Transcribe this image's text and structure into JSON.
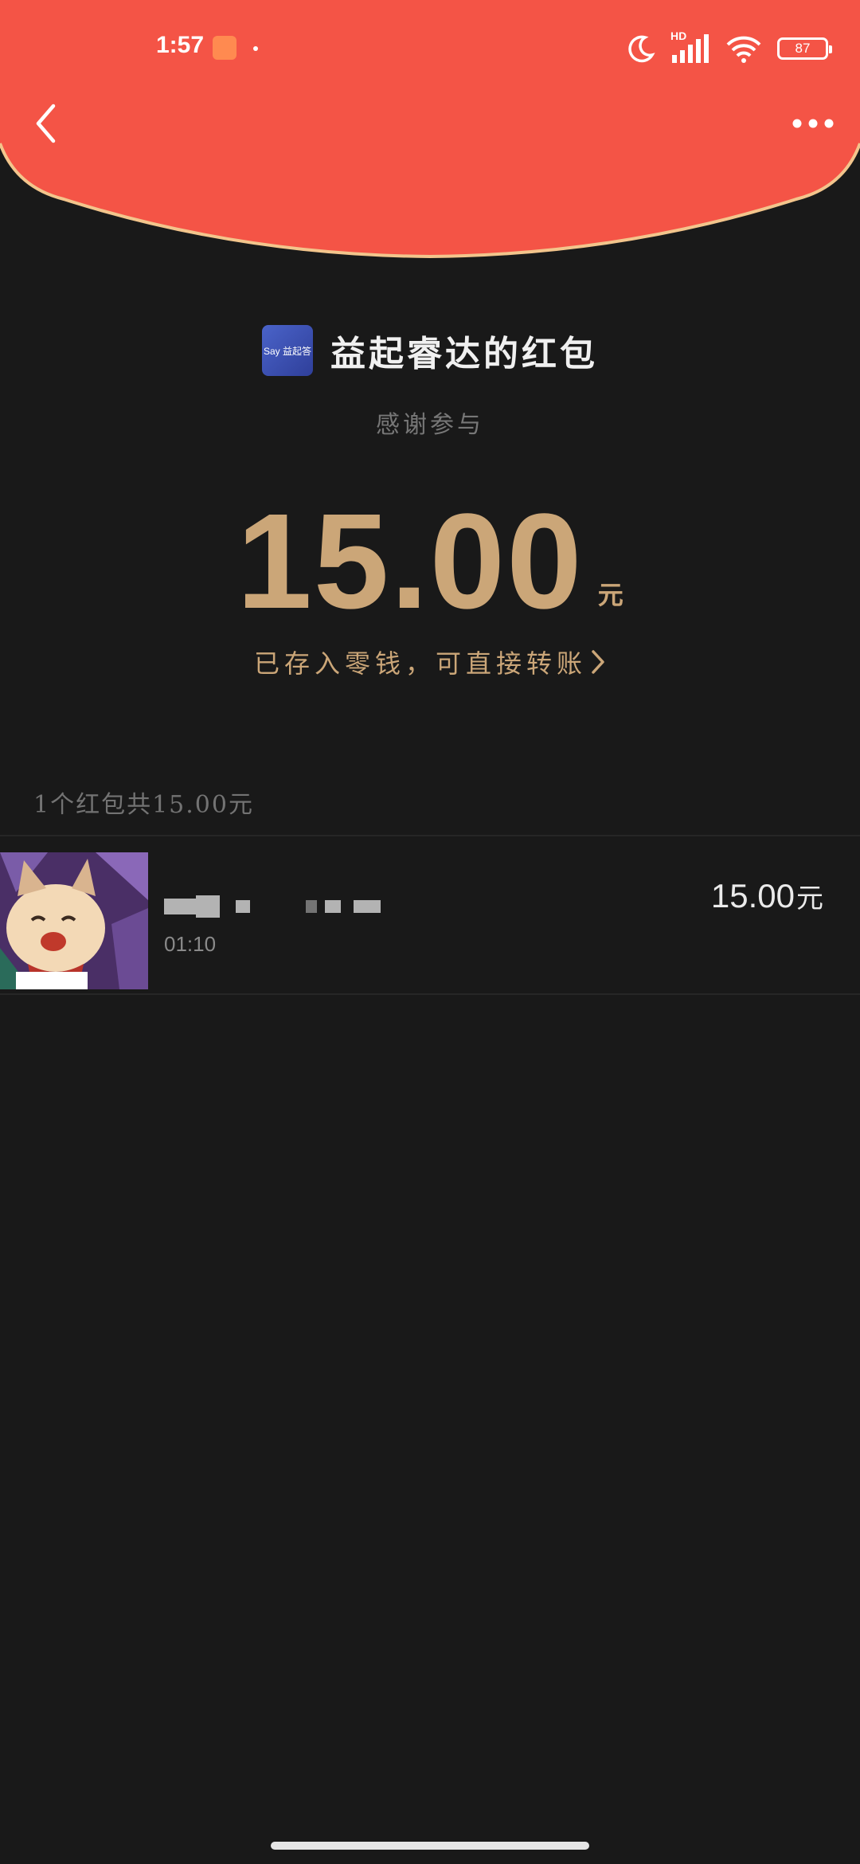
{
  "status_bar": {
    "time": "1:57",
    "network": "HD",
    "battery": "87",
    "icons": [
      "notification-app-icon",
      "moon-icon",
      "signal-icon",
      "wifi-icon",
      "battery-icon"
    ]
  },
  "nav": {
    "back_icon": "chevron-left-icon",
    "more_icon": "more-dots-icon"
  },
  "colors": {
    "header_red": "#f45446",
    "gold": "#cba678",
    "background": "#191919"
  },
  "sender": {
    "logo_text": "Say 益起答",
    "name": "益起睿达的红包"
  },
  "message": "感谢参与",
  "amount": {
    "value": "15.00",
    "unit": "元"
  },
  "saved_link": "已存入零钱，可直接转账",
  "summary": "1个红包共15.00元",
  "records": [
    {
      "time": "01:10",
      "amount": "15.00",
      "unit": "元"
    }
  ]
}
